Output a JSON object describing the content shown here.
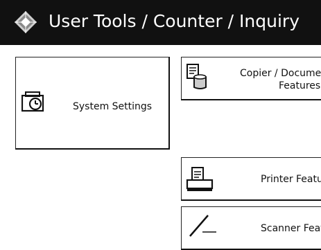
{
  "header": {
    "title": "User Tools / Counter / Inquiry",
    "icon": "user-tools-diamond-icon",
    "background": "#111111",
    "text_color": "#ffffff"
  },
  "tiles": {
    "system_settings": {
      "label": "System Settings",
      "icon": "clock-folder-icon"
    },
    "copier": {
      "label_line1": "Copier / Document",
      "label_line2": "Features",
      "icon": "document-stack-icon"
    },
    "printer": {
      "label": "Printer Featu",
      "icon": "printer-icon"
    },
    "scanner": {
      "label": "Scanner Featu",
      "icon": "scanner-icon"
    }
  }
}
